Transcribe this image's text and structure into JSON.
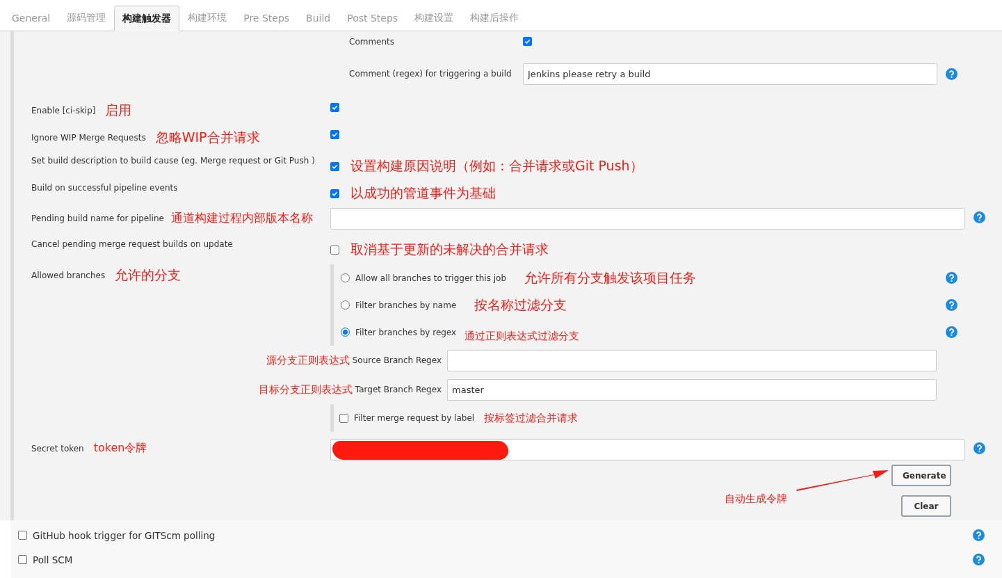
{
  "tabs": [
    {
      "label": "General",
      "selected": false
    },
    {
      "label": "源码管理",
      "selected": false
    },
    {
      "label": "构建触发器",
      "selected": true
    },
    {
      "label": "构建环境",
      "selected": false
    },
    {
      "label": "Pre Steps",
      "selected": false
    },
    {
      "label": "Build",
      "selected": false
    },
    {
      "label": "Post Steps",
      "selected": false
    },
    {
      "label": "构建设置",
      "selected": false
    },
    {
      "label": "构建后操作",
      "selected": false
    }
  ],
  "comments": {
    "label": "Comments",
    "checked": true
  },
  "comment_regex": {
    "label": "Comment (regex) for triggering a build",
    "value": "Jenkins please retry a build"
  },
  "settings": [
    {
      "kind": "checkbox",
      "label": "Enable [ci-skip]",
      "label_note": "启用",
      "checked": true
    },
    {
      "kind": "checkbox",
      "label": "Ignore WIP Merge Requests",
      "label_note": "忽略WIP合并请求",
      "checked": true
    },
    {
      "kind": "checkbox",
      "label": "Set build description to build cause (eg. Merge request or Git Push )",
      "control_note": "设置构建原因说明（例如：合并请求或Git Push）",
      "checked": true
    },
    {
      "kind": "checkbox",
      "label": "Build on successful pipeline events",
      "control_note": "以成功的管道事件为基础",
      "checked": true
    },
    {
      "kind": "text",
      "label": "Pending build name for pipeline",
      "label_note": "通道构建过程内部版本名称"
    },
    {
      "kind": "checkbox",
      "label": "Cancel pending merge request builds on update",
      "control_note": "取消基于更新的未解决的合并请求",
      "checked": false
    }
  ],
  "allowed_branches": {
    "label": "Allowed branches",
    "label_note": "允许的分支",
    "options": [
      {
        "label": "Allow all branches to trigger this job",
        "note": "允许所有分支触发该项目任务",
        "selected": false
      },
      {
        "label": "Filter branches by name",
        "note": "按名称过滤分支",
        "selected": false
      },
      {
        "label": "Filter branches by regex",
        "note": "通过正则表达式过滤分支",
        "selected": true
      }
    ],
    "regexes": [
      {
        "label": "Source Branch Regex",
        "note": "源分支正则表达式"
      },
      {
        "label": "Target Branch Regex",
        "note": "目标分支正则表达式",
        "value": "master"
      }
    ],
    "label_filter": {
      "label": "Filter merge request by label",
      "note": "按标签过滤合并请求",
      "checked": false
    }
  },
  "secret_token": {
    "label": "Secret token",
    "label_note": "token令牌",
    "buttons": [
      "Generate",
      "Clear"
    ],
    "arrow_note": "自动生成令牌"
  },
  "triggers": [
    {
      "label": "GitHub hook trigger for GITScm polling",
      "checked": false
    },
    {
      "label": "Poll SCM",
      "checked": false
    }
  ]
}
